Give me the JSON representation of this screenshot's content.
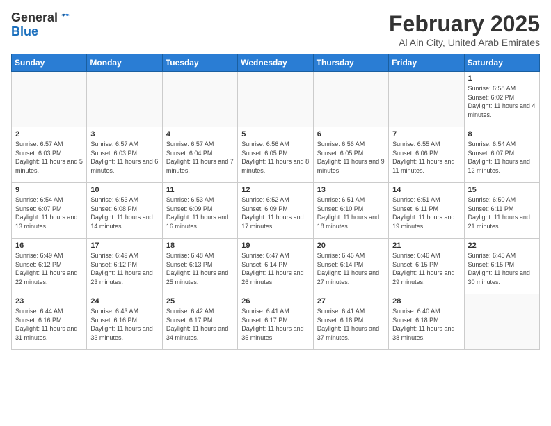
{
  "header": {
    "logo_general": "General",
    "logo_blue": "Blue",
    "month": "February 2025",
    "location": "Al Ain City, United Arab Emirates"
  },
  "weekdays": [
    "Sunday",
    "Monday",
    "Tuesday",
    "Wednesday",
    "Thursday",
    "Friday",
    "Saturday"
  ],
  "weeks": [
    [
      {
        "day": "",
        "info": ""
      },
      {
        "day": "",
        "info": ""
      },
      {
        "day": "",
        "info": ""
      },
      {
        "day": "",
        "info": ""
      },
      {
        "day": "",
        "info": ""
      },
      {
        "day": "",
        "info": ""
      },
      {
        "day": "1",
        "info": "Sunrise: 6:58 AM\nSunset: 6:02 PM\nDaylight: 11 hours and 4 minutes."
      }
    ],
    [
      {
        "day": "2",
        "info": "Sunrise: 6:57 AM\nSunset: 6:03 PM\nDaylight: 11 hours and 5 minutes."
      },
      {
        "day": "3",
        "info": "Sunrise: 6:57 AM\nSunset: 6:03 PM\nDaylight: 11 hours and 6 minutes."
      },
      {
        "day": "4",
        "info": "Sunrise: 6:57 AM\nSunset: 6:04 PM\nDaylight: 11 hours and 7 minutes."
      },
      {
        "day": "5",
        "info": "Sunrise: 6:56 AM\nSunset: 6:05 PM\nDaylight: 11 hours and 8 minutes."
      },
      {
        "day": "6",
        "info": "Sunrise: 6:56 AM\nSunset: 6:05 PM\nDaylight: 11 hours and 9 minutes."
      },
      {
        "day": "7",
        "info": "Sunrise: 6:55 AM\nSunset: 6:06 PM\nDaylight: 11 hours and 11 minutes."
      },
      {
        "day": "8",
        "info": "Sunrise: 6:54 AM\nSunset: 6:07 PM\nDaylight: 11 hours and 12 minutes."
      }
    ],
    [
      {
        "day": "9",
        "info": "Sunrise: 6:54 AM\nSunset: 6:07 PM\nDaylight: 11 hours and 13 minutes."
      },
      {
        "day": "10",
        "info": "Sunrise: 6:53 AM\nSunset: 6:08 PM\nDaylight: 11 hours and 14 minutes."
      },
      {
        "day": "11",
        "info": "Sunrise: 6:53 AM\nSunset: 6:09 PM\nDaylight: 11 hours and 16 minutes."
      },
      {
        "day": "12",
        "info": "Sunrise: 6:52 AM\nSunset: 6:09 PM\nDaylight: 11 hours and 17 minutes."
      },
      {
        "day": "13",
        "info": "Sunrise: 6:51 AM\nSunset: 6:10 PM\nDaylight: 11 hours and 18 minutes."
      },
      {
        "day": "14",
        "info": "Sunrise: 6:51 AM\nSunset: 6:11 PM\nDaylight: 11 hours and 19 minutes."
      },
      {
        "day": "15",
        "info": "Sunrise: 6:50 AM\nSunset: 6:11 PM\nDaylight: 11 hours and 21 minutes."
      }
    ],
    [
      {
        "day": "16",
        "info": "Sunrise: 6:49 AM\nSunset: 6:12 PM\nDaylight: 11 hours and 22 minutes."
      },
      {
        "day": "17",
        "info": "Sunrise: 6:49 AM\nSunset: 6:12 PM\nDaylight: 11 hours and 23 minutes."
      },
      {
        "day": "18",
        "info": "Sunrise: 6:48 AM\nSunset: 6:13 PM\nDaylight: 11 hours and 25 minutes."
      },
      {
        "day": "19",
        "info": "Sunrise: 6:47 AM\nSunset: 6:14 PM\nDaylight: 11 hours and 26 minutes."
      },
      {
        "day": "20",
        "info": "Sunrise: 6:46 AM\nSunset: 6:14 PM\nDaylight: 11 hours and 27 minutes."
      },
      {
        "day": "21",
        "info": "Sunrise: 6:46 AM\nSunset: 6:15 PM\nDaylight: 11 hours and 29 minutes."
      },
      {
        "day": "22",
        "info": "Sunrise: 6:45 AM\nSunset: 6:15 PM\nDaylight: 11 hours and 30 minutes."
      }
    ],
    [
      {
        "day": "23",
        "info": "Sunrise: 6:44 AM\nSunset: 6:16 PM\nDaylight: 11 hours and 31 minutes."
      },
      {
        "day": "24",
        "info": "Sunrise: 6:43 AM\nSunset: 6:16 PM\nDaylight: 11 hours and 33 minutes."
      },
      {
        "day": "25",
        "info": "Sunrise: 6:42 AM\nSunset: 6:17 PM\nDaylight: 11 hours and 34 minutes."
      },
      {
        "day": "26",
        "info": "Sunrise: 6:41 AM\nSunset: 6:17 PM\nDaylight: 11 hours and 35 minutes."
      },
      {
        "day": "27",
        "info": "Sunrise: 6:41 AM\nSunset: 6:18 PM\nDaylight: 11 hours and 37 minutes."
      },
      {
        "day": "28",
        "info": "Sunrise: 6:40 AM\nSunset: 6:18 PM\nDaylight: 11 hours and 38 minutes."
      },
      {
        "day": "",
        "info": ""
      }
    ]
  ]
}
